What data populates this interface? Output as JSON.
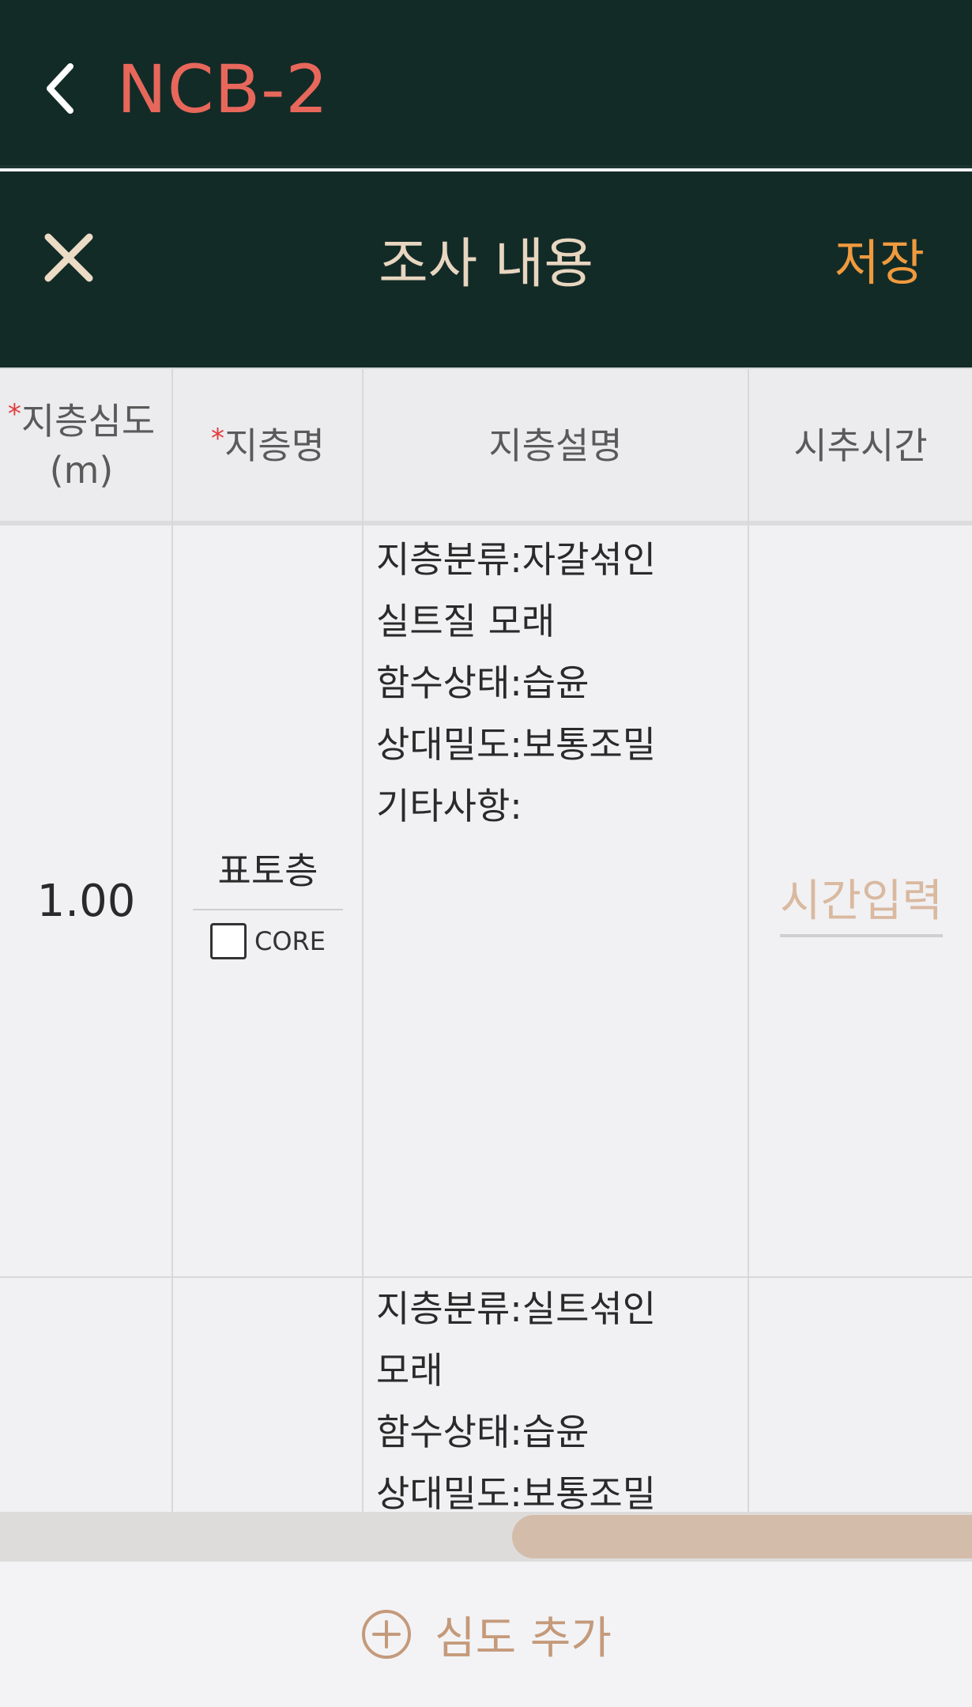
{
  "nav": {
    "title": "NCB-2"
  },
  "modal": {
    "title": "조사 내용",
    "save_label": "저장"
  },
  "table": {
    "headers": {
      "depth_line1": "지층심도",
      "depth_line2": "(m)",
      "layer_name": "지층명",
      "description": "지층설명",
      "time": "시추시간"
    },
    "required_mark": "*",
    "rows": [
      {
        "depth": "1.00",
        "layer_name": "표토층",
        "core_label": "CORE",
        "core_checked": false,
        "description": "지층분류:자갈섞인\n실트질 모래\n함수상태:습윤\n상대밀도:보통조밀\n기타사항:",
        "time_placeholder": "시간입력"
      },
      {
        "depth": "",
        "layer_name": "",
        "description": "지층분류:실트섞인\n모래\n함수상태:습윤\n상대밀도:보통조밀",
        "time_placeholder": ""
      }
    ]
  },
  "add_depth_label": "심도 추가",
  "colors": {
    "header_bg": "#132b27",
    "nav_title": "#e8675b",
    "save": "#f09a3e",
    "accent": "#c49a7b",
    "required": "#e23b3b"
  },
  "icons": {
    "back": "chevron-left-icon",
    "close": "close-icon",
    "add": "plus-circle-icon"
  }
}
